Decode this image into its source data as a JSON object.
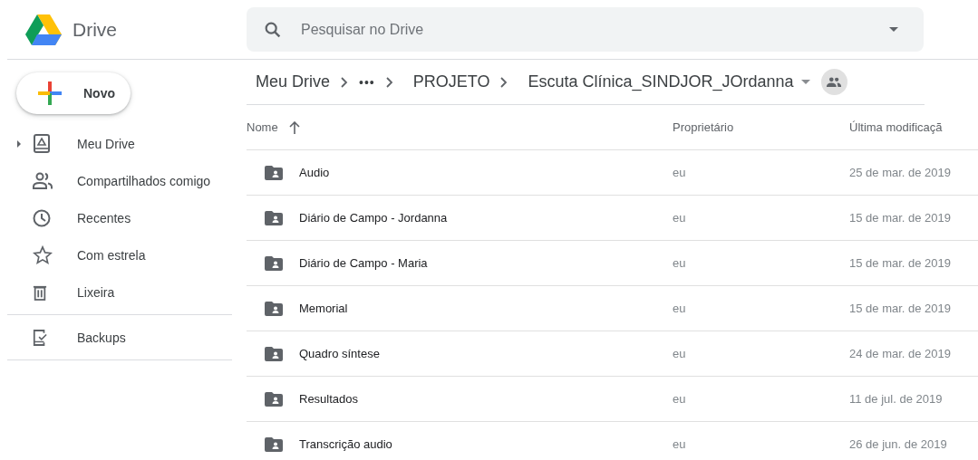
{
  "app": {
    "name": "Drive"
  },
  "search": {
    "placeholder": "Pesquisar no Drive"
  },
  "new_button": {
    "label": "Novo"
  },
  "sidebar": {
    "groups": [
      {
        "items": [
          {
            "label": "Meu Drive",
            "kind": "expandable"
          },
          {
            "label": "Compartilhados comigo",
            "kind": "link"
          },
          {
            "label": "Recentes",
            "kind": "link"
          },
          {
            "label": "Com estrela",
            "kind": "link"
          },
          {
            "label": "Lixeira",
            "kind": "link"
          }
        ]
      },
      {
        "items": [
          {
            "label": "Backups",
            "kind": "link"
          }
        ]
      }
    ]
  },
  "breadcrumb": [
    {
      "label": "Meu Drive",
      "kind": "link"
    },
    {
      "label": "•••",
      "kind": "more"
    },
    {
      "label": "PROJETO",
      "kind": "link"
    },
    {
      "label": "Escuta Clínica_SINDJOR_JOrdanna",
      "kind": "current",
      "shared": true
    }
  ],
  "table": {
    "columns": [
      {
        "label": "Nome",
        "sorted": true
      },
      {
        "label": "Proprietário",
        "sorted": false
      },
      {
        "label": "Última modificaçã",
        "sorted": false
      }
    ],
    "rows": [
      {
        "name": "Audio",
        "owner": "eu",
        "modified": "25 de mar. de 2019"
      },
      {
        "name": "Diário de Campo - Jordanna",
        "owner": "eu",
        "modified": "15 de mar. de 2019"
      },
      {
        "name": "Diário de Campo - Maria",
        "owner": "eu",
        "modified": "15 de mar. de 2019"
      },
      {
        "name": "Memorial",
        "owner": "eu",
        "modified": "15 de mar. de 2019"
      },
      {
        "name": "Quadro síntese",
        "owner": "eu",
        "modified": "24 de mar. de 2019"
      },
      {
        "name": "Resultados",
        "owner": "eu",
        "modified": "11 de jul. de 2019"
      },
      {
        "name": "Transcrição audio",
        "owner": "eu",
        "modified": "26 de jun. de 2019"
      }
    ]
  }
}
